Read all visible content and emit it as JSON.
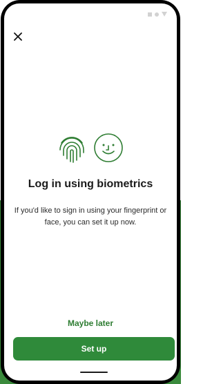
{
  "colors": {
    "brand_green": "#2f8a3a",
    "background_green": "#3a8a3c",
    "text_dark": "#1a1a1a"
  },
  "header": {
    "close_icon": "close-icon"
  },
  "status_bar": {
    "icons": [
      "signal-icon",
      "wifi-icon",
      "battery-icon"
    ]
  },
  "hero": {
    "icons": [
      "fingerprint-icon",
      "face-icon"
    ],
    "title": "Log in using biometrics",
    "description": "If you'd like to sign in using your fingerprint or face, you can set it up now."
  },
  "actions": {
    "secondary_label": "Maybe later",
    "primary_label": "Set up"
  }
}
